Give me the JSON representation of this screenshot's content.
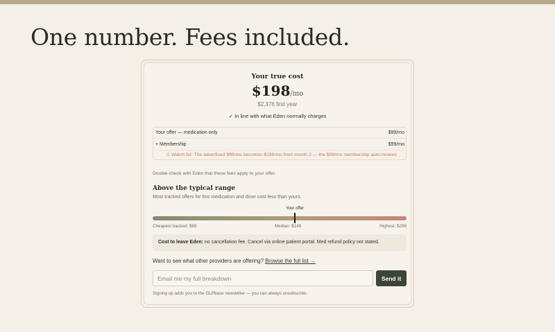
{
  "headline": "One number. Fees included.",
  "cost": {
    "title": "Your true cost",
    "amount": "$198",
    "unit": "/mo",
    "first_year": "$2,376 first year",
    "check": "✓ In line with what Eden normally charges"
  },
  "breakdown": {
    "rows": [
      {
        "label": "Your offer — medication only",
        "value": "$99/mo"
      },
      {
        "label": "+ Membership",
        "value": "$99/mo"
      }
    ],
    "warning": "⚠ Watch for: The advertised $99/mo becomes $198/mo from month 2 — the $99/mo membership auto-renews"
  },
  "double_check": "Double-check with Eden that these fees apply to your offer.",
  "range": {
    "title": "Above the typical range",
    "subtitle": "Most tracked offers for this medication and dose cost less than yours.",
    "your_offer_label": "Your offer",
    "your_offer_value": 198,
    "min_value": 69,
    "max_value": 299,
    "min_label": "Cheapest tracked: $69",
    "median_label": "Median: $149",
    "max_label": "Highest: $299"
  },
  "leave": {
    "label": "Cost to leave Eden:",
    "text": " no cancellation fee. Cancel via online patient portal. Med refund policy not stated."
  },
  "providers": {
    "question": "Want to see what other providers are offering?",
    "link": "Browse the full list →"
  },
  "email": {
    "placeholder": "Email me my full breakdown",
    "button": "Send it"
  },
  "signup_note": "Signing up adds you to the GLPbase newsletter — you can always unsubscribe.",
  "colors": {
    "accent_dark": "#3b4538",
    "warning": "#c07a64",
    "top_bar": "#b7a58c"
  }
}
